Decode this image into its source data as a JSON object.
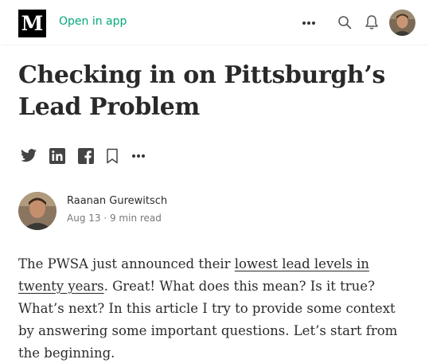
{
  "header": {
    "logo_letter": "M",
    "open_in_app": "Open in app",
    "icons": [
      "more-icon",
      "search-icon",
      "bell-icon",
      "avatar"
    ]
  },
  "article": {
    "title": "Checking in on Pittsburgh’s Lead Problem",
    "share_icons": [
      "twitter-icon",
      "linkedin-icon",
      "facebook-icon",
      "bookmark-icon",
      "more-icon"
    ],
    "author": {
      "name": "Raanan Gurewitsch",
      "date": "Aug 13",
      "separator": " · ",
      "read_time": "9 min read"
    },
    "body": {
      "intro": "The PWSA just announced their ",
      "link_text": "lowest lead levels in twenty years",
      "rest": ". Great! What does this mean? Is it true? What’s next? In this article I try to provide some context by answering some important questions. Let’s start from the beginning."
    }
  },
  "colors": {
    "accent_green": "#03a87c",
    "text": "rgba(0,0,0,0.84)",
    "meta": "rgba(0,0,0,0.54)"
  }
}
